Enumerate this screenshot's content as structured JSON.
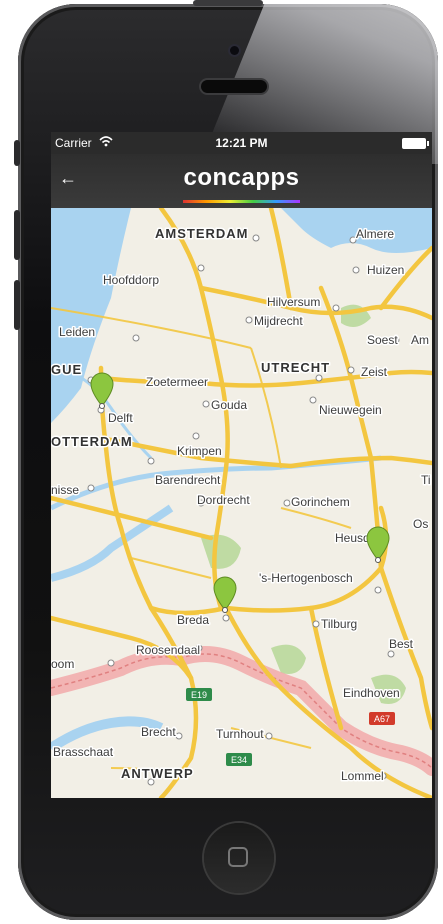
{
  "status_bar": {
    "carrier": "Carrier",
    "wifi_icon": "wifi-icon",
    "time": "12:21 PM",
    "battery_icon": "battery-icon"
  },
  "nav": {
    "back_icon": "back-arrow-icon",
    "back_glyph": "←",
    "brand": "concapps"
  },
  "colors": {
    "nav_bg": "#2e2e2e",
    "map_water": "#a9d3f0",
    "road": "#f3c640",
    "pin": "#8cc63f",
    "border_belt": "#f2a9a9"
  },
  "map": {
    "cities": [
      {
        "id": "amsterdam",
        "label": "AMSTERDAM",
        "big": true
      },
      {
        "id": "almere",
        "label": "Almere"
      },
      {
        "id": "hoofddorp",
        "label": "Hoofddorp"
      },
      {
        "id": "huizen",
        "label": "Huizen"
      },
      {
        "id": "hilversum",
        "label": "Hilversum"
      },
      {
        "id": "mijdrecht",
        "label": "Mijdrecht"
      },
      {
        "id": "leiden",
        "label": "Leiden"
      },
      {
        "id": "soest",
        "label": "Soest"
      },
      {
        "id": "am",
        "label": "Am"
      },
      {
        "id": "gue",
        "label": "GUE"
      },
      {
        "id": "zoetermeer",
        "label": "Zoetermeer"
      },
      {
        "id": "utrecht",
        "label": "UTRECHT",
        "big": true
      },
      {
        "id": "zeist",
        "label": "Zeist"
      },
      {
        "id": "delft",
        "label": "Delft"
      },
      {
        "id": "gouda",
        "label": "Gouda"
      },
      {
        "id": "nieuwegein",
        "label": "Nieuwegein"
      },
      {
        "id": "otterdam",
        "label": "OTTERDAM",
        "big": true
      },
      {
        "id": "krimpen",
        "label": "Krimpen"
      },
      {
        "id": "nisse",
        "label": "nisse"
      },
      {
        "id": "barendrecht",
        "label": "Barendrecht"
      },
      {
        "id": "dordrecht",
        "label": "Dordrecht"
      },
      {
        "id": "gorinchem",
        "label": "Gorinchem"
      },
      {
        "id": "ti",
        "label": "Ti"
      },
      {
        "id": "heusden",
        "label": "Heusd"
      },
      {
        "id": "os",
        "label": "Os"
      },
      {
        "id": "hertogenbosch",
        "label": "'s-Hertogenbosch"
      },
      {
        "id": "breda",
        "label": "Breda"
      },
      {
        "id": "tilburg",
        "label": "Tilburg"
      },
      {
        "id": "roosendaal",
        "label": "Roosendaal"
      },
      {
        "id": "best",
        "label": "Best"
      },
      {
        "id": "oom",
        "label": "oom"
      },
      {
        "id": "eindhoven",
        "label": "Eindhoven"
      },
      {
        "id": "brecht",
        "label": "Brecht"
      },
      {
        "id": "turnhout",
        "label": "Turnhout"
      },
      {
        "id": "brasschaat",
        "label": "Brasschaat"
      },
      {
        "id": "antwerp",
        "label": "ANTWERP",
        "big": true
      },
      {
        "id": "lommel",
        "label": "Lommel"
      }
    ],
    "road_shields": [
      {
        "id": "e19",
        "label": "E19",
        "color": "#2e8b4a"
      },
      {
        "id": "e34",
        "label": "E34",
        "color": "#2e8b4a"
      },
      {
        "id": "a67",
        "label": "A67",
        "color": "#d23b2b"
      }
    ],
    "pins": [
      {
        "id": "pin-delft",
        "near": "Delft"
      },
      {
        "id": "pin-breda",
        "near": "Breda"
      },
      {
        "id": "pin-heusden",
        "near": "Heusden"
      }
    ]
  }
}
